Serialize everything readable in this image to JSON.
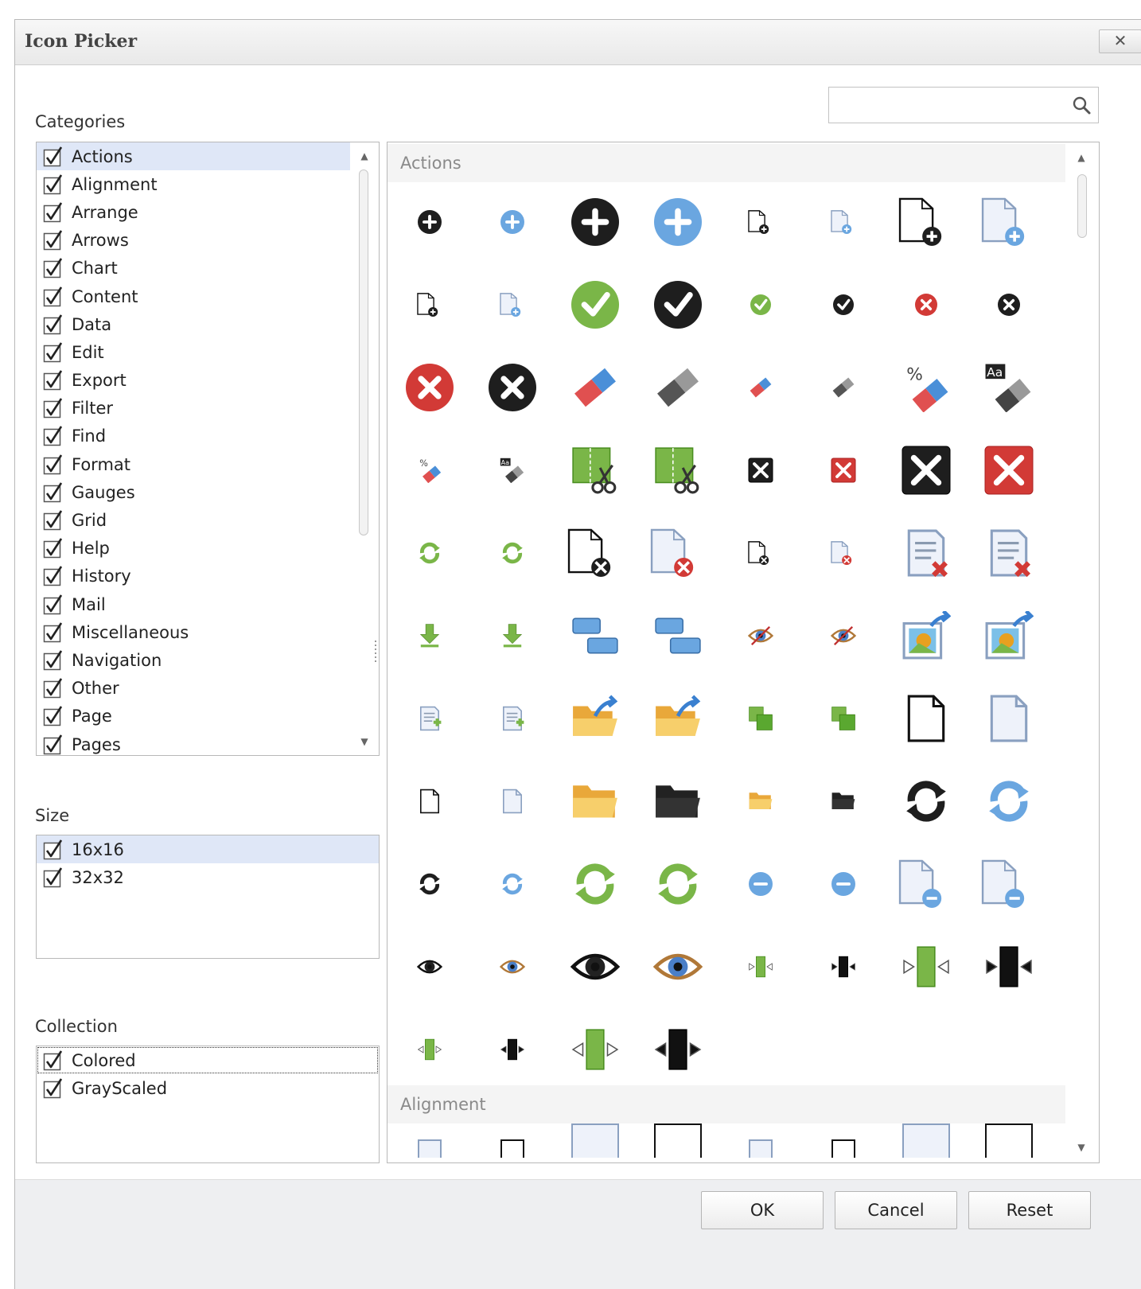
{
  "window": {
    "title": "Icon Picker",
    "close_label": "✕"
  },
  "search": {
    "value": "",
    "placeholder": ""
  },
  "categories": {
    "label": "Categories",
    "items": [
      {
        "label": "Actions",
        "checked": true,
        "selected": true
      },
      {
        "label": "Alignment",
        "checked": true
      },
      {
        "label": "Arrange",
        "checked": true
      },
      {
        "label": "Arrows",
        "checked": true
      },
      {
        "label": "Chart",
        "checked": true
      },
      {
        "label": "Content",
        "checked": true
      },
      {
        "label": "Data",
        "checked": true
      },
      {
        "label": "Edit",
        "checked": true
      },
      {
        "label": "Export",
        "checked": true
      },
      {
        "label": "Filter",
        "checked": true
      },
      {
        "label": "Find",
        "checked": true
      },
      {
        "label": "Format",
        "checked": true
      },
      {
        "label": "Gauges",
        "checked": true
      },
      {
        "label": "Grid",
        "checked": true
      },
      {
        "label": "Help",
        "checked": true
      },
      {
        "label": "History",
        "checked": true
      },
      {
        "label": "Mail",
        "checked": true
      },
      {
        "label": "Miscellaneous",
        "checked": true
      },
      {
        "label": "Navigation",
        "checked": true
      },
      {
        "label": "Other",
        "checked": true
      },
      {
        "label": "Page",
        "checked": true
      },
      {
        "label": "Pages",
        "checked": true
      }
    ]
  },
  "size": {
    "label": "Size",
    "items": [
      {
        "label": "16x16",
        "checked": true,
        "selected": true
      },
      {
        "label": "32x32",
        "checked": true
      }
    ]
  },
  "collection": {
    "label": "Collection",
    "items": [
      {
        "label": "Colored",
        "checked": true,
        "focused": true
      },
      {
        "label": "GrayScaled",
        "checked": true
      }
    ]
  },
  "gallery": {
    "groups": [
      {
        "header": "Actions",
        "icons": [
          "add-icon",
          "add-icon",
          "add-icon",
          "add-icon",
          "new-document-icon",
          "new-document-icon",
          "new-document-icon",
          "new-document-icon",
          "new-document-icon",
          "new-document-icon",
          "apply-icon",
          "apply-icon",
          "apply-icon",
          "apply-icon",
          "cancel-icon",
          "cancel-icon",
          "cancel-icon",
          "cancel-icon",
          "clear-icon",
          "clear-icon",
          "clear-icon",
          "clear-icon",
          "clear-formatting-icon",
          "clear-formatting-icon",
          "clear-formatting-icon",
          "clear-formatting-icon",
          "cut-icon",
          "cut-icon",
          "close-icon",
          "close-icon",
          "close-icon",
          "close-icon",
          "convert-icon",
          "convert-icon",
          "delete-document-icon",
          "delete-document-icon",
          "delete-document-icon",
          "delete-document-icon",
          "delete-list-icon",
          "delete-list-icon",
          "download-icon",
          "download-icon",
          "group-icon",
          "group-icon",
          "hide-icon",
          "hide-icon",
          "insert-image-icon",
          "insert-image-icon",
          "insert-list-icon",
          "insert-list-icon",
          "open-icon",
          "open-icon",
          "merge-icon",
          "merge-icon",
          "new-icon",
          "new-icon",
          "new-icon",
          "new-icon",
          "folder-icon",
          "folder-icon",
          "folder-icon",
          "folder-icon",
          "refresh-icon",
          "refresh-icon",
          "refresh-icon",
          "refresh-icon",
          "redo-icon",
          "redo-icon",
          "remove-icon",
          "remove-icon",
          "remove-document-icon",
          "remove-document-icon",
          "show-icon",
          "show-icon",
          "show-icon",
          "show-icon",
          "split-icon",
          "split-icon",
          "split-icon",
          "split-icon",
          "stretch-icon",
          "stretch-icon",
          "stretch-icon",
          "stretch-icon"
        ]
      },
      {
        "header": "Alignment"
      }
    ]
  },
  "buttons": {
    "ok": "OK",
    "cancel": "Cancel",
    "reset": "Reset"
  },
  "colors": {
    "selection": "#dfe7f7",
    "footer": "#eeeff1",
    "header_text": "#8a8a8a"
  }
}
